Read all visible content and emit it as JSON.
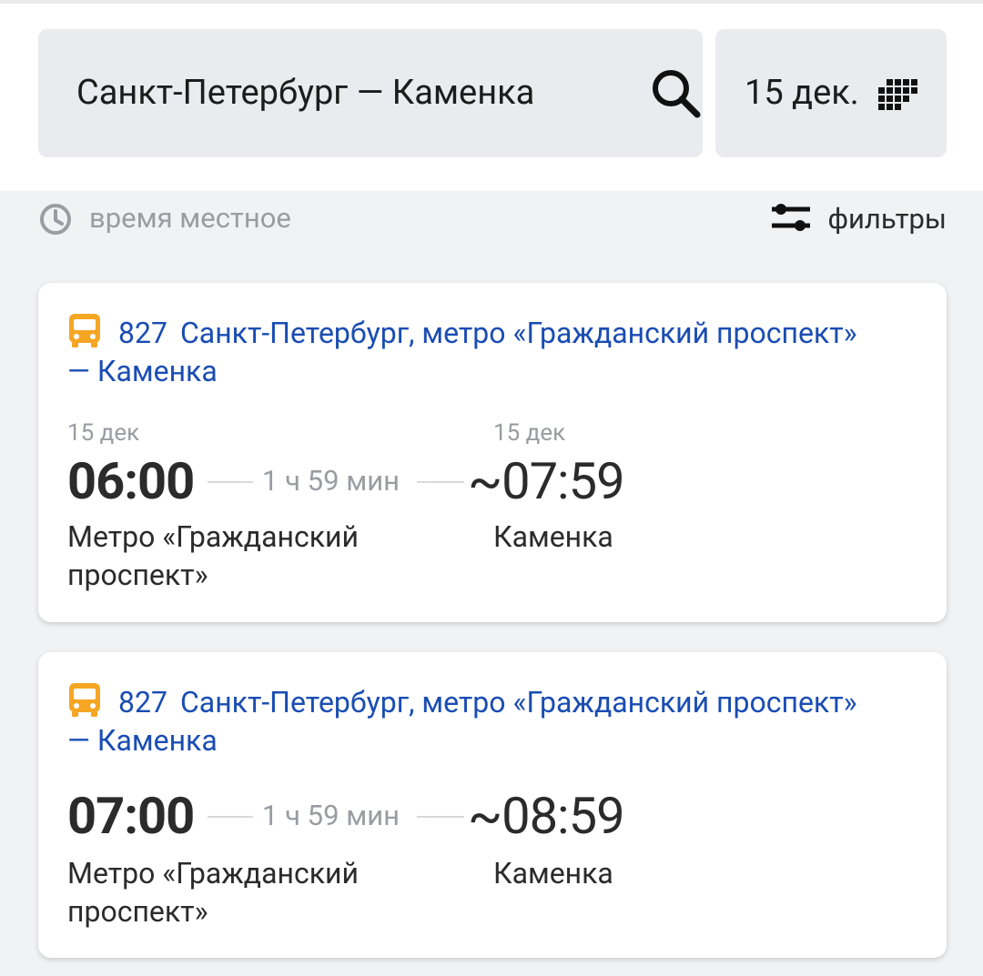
{
  "search": {
    "route_query": "Санкт-Петербург — Каменка",
    "date": "15 дек."
  },
  "subbar": {
    "time_note": "время местное",
    "filters_label": "фильтры"
  },
  "trips": [
    {
      "route_number": "827",
      "route_name": "Санкт-Петербург, метро «Гражданский проспект» — Каменка",
      "departure_date": "15 дек",
      "departure_time": "06:00",
      "duration": "1 ч 59 мин",
      "arrival_date": "15 дек",
      "arrival_time": "~07:59",
      "departure_station": "Метро «Гражданский проспект»",
      "arrival_station": "Каменка"
    },
    {
      "route_number": "827",
      "route_name": "Санкт-Петербург, метро «Гражданский проспект» — Каменка",
      "departure_time": "07:00",
      "duration": "1 ч 59 мин",
      "arrival_time": "~08:59",
      "departure_station": "Метро «Гражданский проспект»",
      "arrival_station": "Каменка"
    }
  ],
  "icons": {
    "search": "search-icon",
    "calendar": "calendar-icon",
    "clock": "clock-icon",
    "filters": "filters-icon",
    "bus": "bus-icon"
  },
  "colors": {
    "link": "#1a4db3",
    "bus_icon": "#f5a623",
    "muted_text": "#9a9ca1",
    "field_bg": "#e9ebee",
    "page_bg": "#f1f2f4"
  }
}
